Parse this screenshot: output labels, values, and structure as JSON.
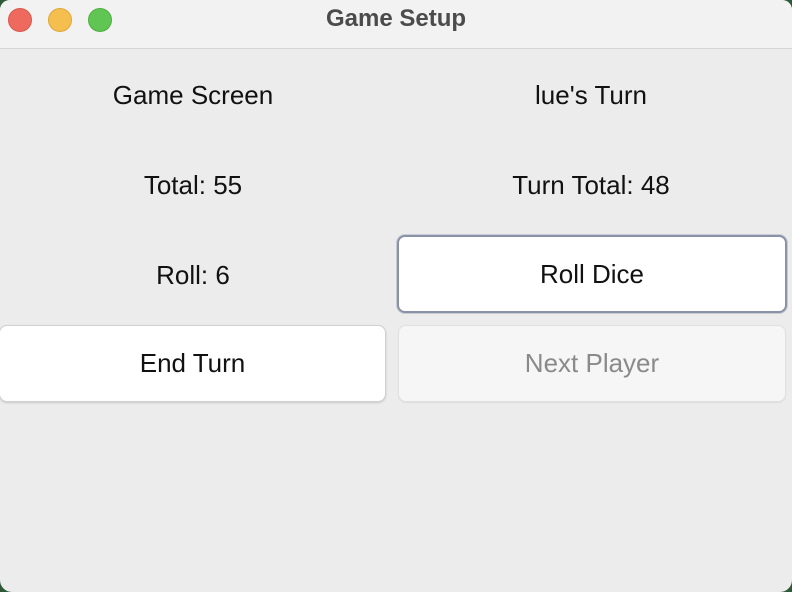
{
  "window": {
    "title": "Game Setup"
  },
  "labels": {
    "screen_title": "Game Screen",
    "turn_label": "lue's Turn",
    "total": "Total: 55",
    "turn_total": "Turn Total: 48",
    "roll": "Roll: 6"
  },
  "buttons": {
    "roll_dice": "Roll Dice",
    "end_turn": "End Turn",
    "next_player": "Next Player"
  },
  "colors": {
    "close": "#ee6a5f",
    "minimize": "#f5bf4f",
    "maximize": "#61c554"
  }
}
